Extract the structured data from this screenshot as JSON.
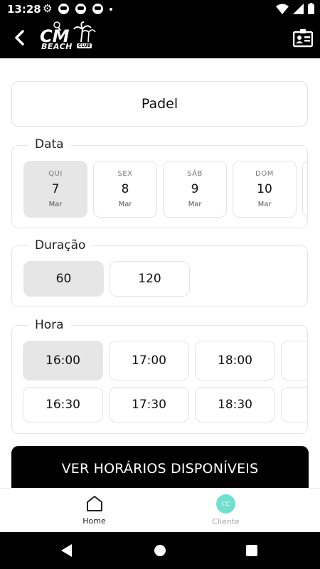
{
  "status_bar": {
    "time": "13:28",
    "icons": [
      "gear-icon",
      "notification-icon",
      "notification-icon",
      "notification-icon",
      "dot-icon",
      "wifi-icon",
      "signal-icon",
      "battery-icon"
    ]
  },
  "header": {
    "back_icon": "chevron-left-icon",
    "logo_text": "BEACH",
    "logo_club": "CLUB",
    "right_icon": "contact-card-icon"
  },
  "sport": {
    "name": "Padel"
  },
  "date_section": {
    "title": "Data",
    "days": [
      {
        "weekday": "QUI",
        "day": "7",
        "month": "Mar",
        "selected": true
      },
      {
        "weekday": "SEX",
        "day": "8",
        "month": "Mar",
        "selected": false
      },
      {
        "weekday": "SÁB",
        "day": "9",
        "month": "Mar",
        "selected": false
      },
      {
        "weekday": "DOM",
        "day": "10",
        "month": "Mar",
        "selected": false
      }
    ]
  },
  "duration_section": {
    "title": "Duração",
    "options": [
      {
        "label": "60",
        "selected": true
      },
      {
        "label": "120",
        "selected": false
      }
    ]
  },
  "time_section": {
    "title": "Hora",
    "row1": [
      {
        "label": "16:00",
        "selected": true
      },
      {
        "label": "17:00",
        "selected": false
      },
      {
        "label": "18:00",
        "selected": false
      }
    ],
    "row2": [
      {
        "label": "16:30",
        "selected": false
      },
      {
        "label": "17:30",
        "selected": false
      },
      {
        "label": "18:30",
        "selected": false
      }
    ]
  },
  "cta": {
    "label": "VER HORÁRIOS DISPONÍVEIS"
  },
  "tab_bar": {
    "home_label": "Home",
    "client_label": "Cliente",
    "client_avatar_text": "CC"
  },
  "colors": {
    "accent_client": "#6fe0cf",
    "selected_tile": "#e6e6e6",
    "cta_background": "#000000"
  }
}
